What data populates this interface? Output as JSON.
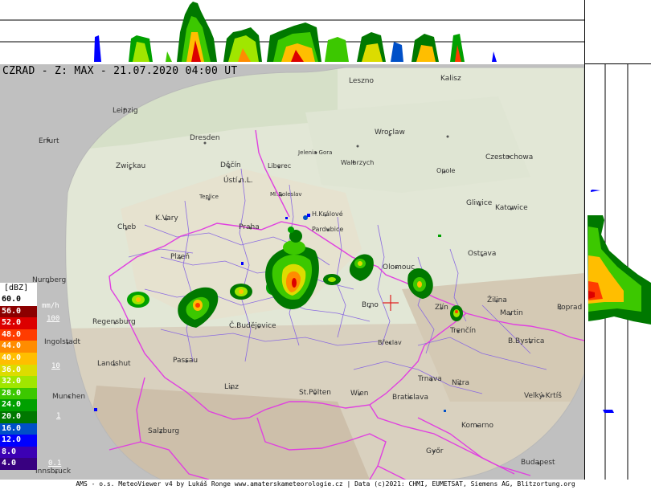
{
  "title": "CZRAD - Z: MAX - 21.07.2020 04:00 UT",
  "footer": "AMS - o.s. MeteoViewer v4 by Lukáš Ronge www.amaterskameteorologie.cz | Data (c)2021: CHMI, EUMETSAT, Siemens AG, Blitzortung.org",
  "legend": {
    "unit_dbz": "[dBZ]",
    "unit_mmh": "mm/h",
    "levels": [
      {
        "label": "60.0",
        "color": "#ffffff",
        "text": "#000000"
      },
      {
        "label": "56.0",
        "color": "#8c0000",
        "text": "#ffffff"
      },
      {
        "label": "52.0",
        "color": "#dc0000",
        "text": "#ffffff"
      },
      {
        "label": "48.0",
        "color": "#ff3c00",
        "text": "#ffffff"
      },
      {
        "label": "44.0",
        "color": "#ff8c00",
        "text": "#ffffff"
      },
      {
        "label": "40.0",
        "color": "#ffbe00",
        "text": "#ffffff"
      },
      {
        "label": "36.0",
        "color": "#dcdc00",
        "text": "#ffffff"
      },
      {
        "label": "32.0",
        "color": "#a0e600",
        "text": "#ffffff"
      },
      {
        "label": "28.0",
        "color": "#3cc800",
        "text": "#ffffff"
      },
      {
        "label": "24.0",
        "color": "#00a000",
        "text": "#ffffff"
      },
      {
        "label": "20.0",
        "color": "#007800",
        "text": "#ffffff"
      },
      {
        "label": "16.0",
        "color": "#0050c8",
        "text": "#ffffff"
      },
      {
        "label": "12.0",
        "color": "#0000ff",
        "text": "#ffffff"
      },
      {
        "label": "8.0",
        "color": "#3c00b4",
        "text": "#ffffff"
      },
      {
        "label": "4.0",
        "color": "#380080",
        "text": "#ffffff"
      }
    ],
    "rain_rates": [
      "100",
      "10",
      "1",
      "0.1"
    ]
  },
  "cities": [
    {
      "name": "Leszno",
      "id": "leszno"
    },
    {
      "name": "Kalisz",
      "id": "kalisz"
    },
    {
      "name": "Leipzig",
      "id": "leipzig"
    },
    {
      "name": "Erfurt",
      "id": "erfurt"
    },
    {
      "name": "Dresden",
      "id": "dresden"
    },
    {
      "name": "Wroclaw",
      "id": "wroclaw"
    },
    {
      "name": "Jelenia Gora",
      "id": "jelenia-gora"
    },
    {
      "name": "Walbrzych",
      "id": "walbrzych"
    },
    {
      "name": "Czestochowa",
      "id": "czestochowa"
    },
    {
      "name": "Zwickau",
      "id": "zwickau"
    },
    {
      "name": "Opole",
      "id": "opole"
    },
    {
      "name": "Děčín",
      "id": "decin"
    },
    {
      "name": "Liberec",
      "id": "liberec"
    },
    {
      "name": "Ústí n.L.",
      "id": "usti"
    },
    {
      "name": "Gliwice",
      "id": "gliwice"
    },
    {
      "name": "Katowice",
      "id": "katowice"
    },
    {
      "name": "Teplice",
      "id": "teplice"
    },
    {
      "name": "Ml.Boleslav",
      "id": "ml-boleslav"
    },
    {
      "name": "H.Králové",
      "id": "hradec"
    },
    {
      "name": "K.Vary",
      "id": "k-vary"
    },
    {
      "name": "Cheb",
      "id": "cheb"
    },
    {
      "name": "Praha",
      "id": "praha"
    },
    {
      "name": "Pardubice",
      "id": "pardubice"
    },
    {
      "name": "Ostrava",
      "id": "ostrava"
    },
    {
      "name": "Plzeň",
      "id": "plzen"
    },
    {
      "name": "Olomouc",
      "id": "olomouc"
    },
    {
      "name": "Nurnberg",
      "id": "nurnberg"
    },
    {
      "name": "Žilina",
      "id": "zilina"
    },
    {
      "name": "Brno",
      "id": "brno"
    },
    {
      "name": "Zlín",
      "id": "zlin"
    },
    {
      "name": "Martin",
      "id": "martin"
    },
    {
      "name": "Poprad",
      "id": "poprad"
    },
    {
      "name": "Regensburg",
      "id": "regensburg"
    },
    {
      "name": "Č.Budějovice",
      "id": "c-budejovice"
    },
    {
      "name": "Trenčín",
      "id": "trencin"
    },
    {
      "name": "Ingolstadt",
      "id": "ingolstadt"
    },
    {
      "name": "B.Bystrica",
      "id": "b-bystrica"
    },
    {
      "name": "Břeclav",
      "id": "breclav"
    },
    {
      "name": "Landshut",
      "id": "landshut"
    },
    {
      "name": "Passau",
      "id": "passau"
    },
    {
      "name": "Trnava",
      "id": "trnava"
    },
    {
      "name": "Nitra",
      "id": "nitra"
    },
    {
      "name": "Linz",
      "id": "linz"
    },
    {
      "name": "St.Pölten",
      "id": "st-polten"
    },
    {
      "name": "Wien",
      "id": "wien"
    },
    {
      "name": "Munchen",
      "id": "munchen"
    },
    {
      "name": "Bratislava",
      "id": "bratislava"
    },
    {
      "name": "Velký Krtíš",
      "id": "velky-krtis"
    },
    {
      "name": "Komarno",
      "id": "komarno"
    },
    {
      "name": "Salzburg",
      "id": "salzburg"
    },
    {
      "name": "Győr",
      "id": "gyor"
    },
    {
      "name": "Budapest",
      "id": "budapest"
    },
    {
      "name": "Innsbruck",
      "id": "innsbruck"
    }
  ]
}
